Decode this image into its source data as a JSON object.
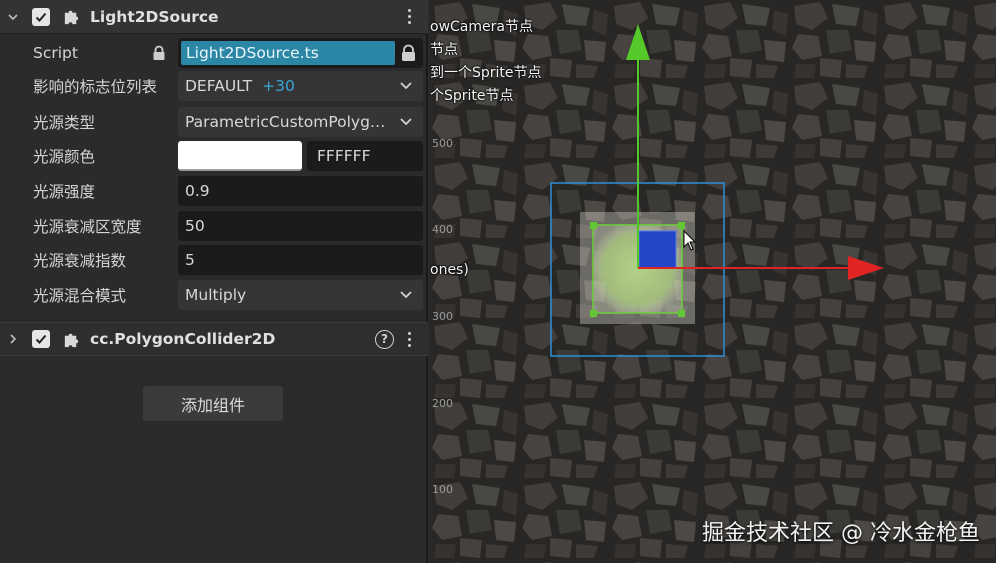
{
  "component": {
    "title": "Light2DSource",
    "script_label": "Script",
    "script_value": "Light2DSource.ts"
  },
  "properties": [
    {
      "label": "影响的标志位列表",
      "value": "DEFAULT",
      "extra": "+30"
    },
    {
      "label": "光源类型",
      "value": "ParametricCustomPolyg…"
    },
    {
      "label": "光源颜色",
      "value": "FFFFFF",
      "color": "#ffffff"
    },
    {
      "label": "光源强度",
      "value": "0.9"
    },
    {
      "label": "光源衰减区宽度",
      "value": "50"
    },
    {
      "label": "光源衰减指数",
      "value": "5"
    },
    {
      "label": "光源混合模式",
      "value": "Multiply"
    }
  ],
  "second_component": {
    "title": "cc.PolygonCollider2D",
    "help": "?"
  },
  "add_component_label": "添加组件",
  "scene": {
    "notes": [
      "owCamera节点",
      "节点",
      "到一个Sprite节点",
      "个Sprite节点",
      "ones)"
    ],
    "ticks": [
      "500",
      "400",
      "300",
      "200",
      "100"
    ],
    "watermark": "掘金技术社区 @ 冷水金枪鱼"
  },
  "colors": {
    "accent": "#2c86a6",
    "x_axis": "#e02424",
    "y_axis": "#55c82a",
    "selection": "#2b8fd6"
  }
}
